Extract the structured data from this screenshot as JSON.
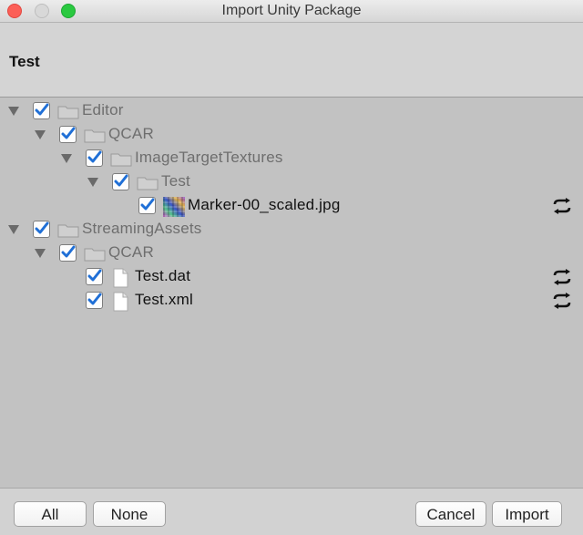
{
  "window": {
    "title": "Import Unity Package"
  },
  "package": {
    "name": "Test"
  },
  "tree": [
    {
      "label": "Editor",
      "type": "folder",
      "checked": true,
      "expanded": true,
      "dim": true,
      "reimport": false
    },
    {
      "label": "QCAR",
      "type": "folder",
      "checked": true,
      "expanded": true,
      "dim": true,
      "reimport": false
    },
    {
      "label": "ImageTargetTextures",
      "type": "folder",
      "checked": true,
      "expanded": true,
      "dim": true,
      "reimport": false
    },
    {
      "label": "Test",
      "type": "folder",
      "checked": true,
      "expanded": true,
      "dim": true,
      "reimport": false
    },
    {
      "label": "Marker-00_scaled.jpg",
      "type": "image",
      "checked": true,
      "dim": false,
      "reimport": true
    },
    {
      "label": "StreamingAssets",
      "type": "folder",
      "checked": true,
      "expanded": true,
      "dim": true,
      "reimport": false
    },
    {
      "label": "QCAR",
      "type": "folder",
      "checked": true,
      "expanded": true,
      "dim": true,
      "reimport": false
    },
    {
      "label": "Test.dat",
      "type": "file",
      "checked": true,
      "dim": false,
      "reimport": true
    },
    {
      "label": "Test.xml",
      "type": "file",
      "checked": true,
      "dim": false,
      "reimport": true
    }
  ],
  "footer": {
    "all_label": "All",
    "none_label": "None",
    "cancel_label": "Cancel",
    "import_label": "Import"
  },
  "colors": {
    "check_blue": "#1f6fd6",
    "folder_gray": "#c9c9c9",
    "arrow_gray": "#6a6a6a"
  }
}
